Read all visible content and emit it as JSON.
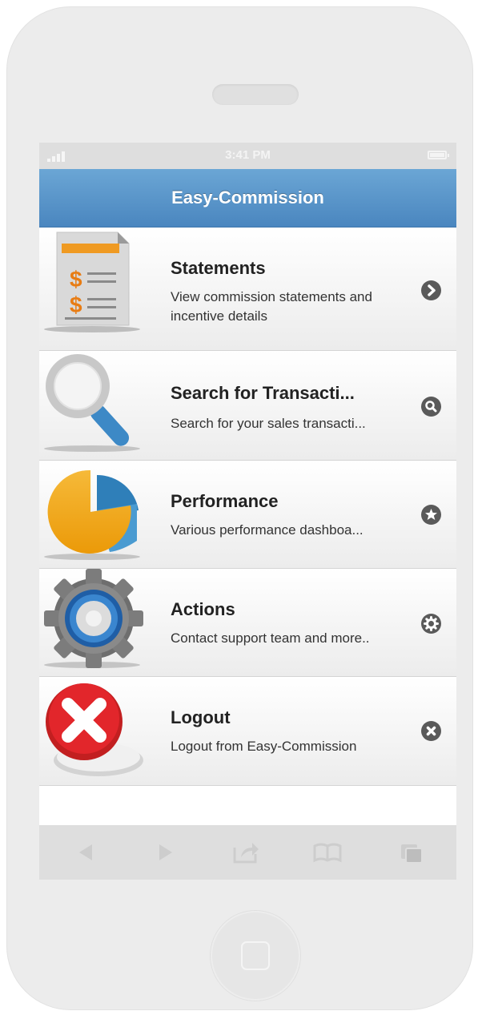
{
  "status_bar": {
    "time": "3:41 PM"
  },
  "header": {
    "title": "Easy-Commission"
  },
  "menu": {
    "items": [
      {
        "title": "Statements",
        "desc": "View commission statements and incentive details",
        "action_icon": "chevron-right-icon"
      },
      {
        "title": "Search for Transacti...",
        "desc": "Search for your sales transacti...",
        "action_icon": "search-icon"
      },
      {
        "title": "Performance",
        "desc": "Various performance dashboa...",
        "action_icon": "star-icon"
      },
      {
        "title": "Actions",
        "desc": "Contact support team and more..",
        "action_icon": "gear-icon"
      },
      {
        "title": "Logout",
        "desc": "Logout from Easy-Commission",
        "action_icon": "close-icon"
      }
    ]
  },
  "toolbar": {
    "buttons": [
      "back-icon",
      "forward-icon",
      "share-icon",
      "bookmarks-icon",
      "tabs-icon"
    ]
  },
  "colors": {
    "header": "#4a86bf",
    "accent": "#5a5a5a"
  }
}
